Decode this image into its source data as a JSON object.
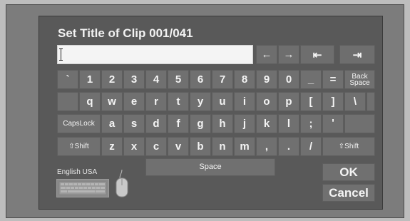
{
  "dialog": {
    "title": "Set Title of Clip 001/041",
    "input_value": ""
  },
  "nav_keys": {
    "left": "←",
    "right": "→",
    "home": "⇤",
    "end": "⇥"
  },
  "keyboard": {
    "row1": [
      "`",
      "1",
      "2",
      "3",
      "4",
      "5",
      "6",
      "7",
      "8",
      "9",
      "0",
      "_",
      "="
    ],
    "backspace": "Back\nSpace",
    "row2": [
      "q",
      "w",
      "e",
      "r",
      "t",
      "y",
      "u",
      "i",
      "o",
      "p",
      "[",
      "]",
      "\\"
    ],
    "capslock": "CapsLock",
    "row3": [
      "a",
      "s",
      "d",
      "f",
      "g",
      "h",
      "j",
      "k",
      "l",
      ";",
      "'"
    ],
    "shift": "⇧Shift",
    "row4": [
      "z",
      "x",
      "c",
      "v",
      "b",
      "n",
      "m",
      ",",
      ".",
      "/"
    ],
    "space": "Space"
  },
  "actions": {
    "ok": "OK",
    "cancel": "Cancel"
  },
  "status": {
    "language": "English USA"
  }
}
